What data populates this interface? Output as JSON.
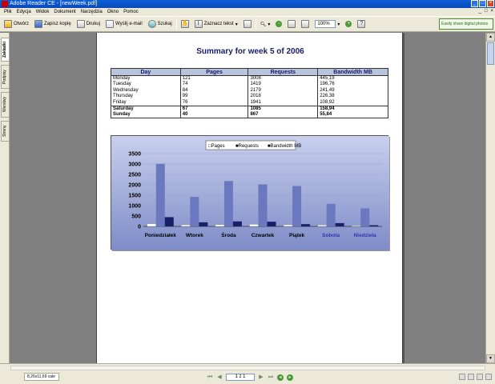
{
  "window": {
    "title": "Adobe Reader CE - [newWeek.pdf]",
    "controls": [
      "_",
      "□",
      "×"
    ]
  },
  "menu": {
    "items": [
      "Plik",
      "Edycja",
      "Widok",
      "Dokument",
      "Narzędzia",
      "Okno",
      "Pomoc"
    ],
    "doc_controls": [
      "_",
      "□",
      "×"
    ]
  },
  "toolbar": {
    "open_label": "Otwórz",
    "save_copy_label": "Zapisz kopię",
    "print_label": "Drukuj",
    "email_label": "Wyślij e-mail",
    "search_label": "Szukaj",
    "select_text_label": "Zaznacz tekst",
    "zoom_value": "100%",
    "sign_box": "Easily share digital photos"
  },
  "nav_tabs": [
    "Zakładki",
    "Podpisy",
    "Warstwy",
    "Strony"
  ],
  "document": {
    "title": "Summary for week 5 of 2006",
    "table": {
      "headers": [
        "Day",
        "Pages",
        "Requests",
        "Bandwidth MB"
      ],
      "rows": [
        [
          "Monday",
          "121",
          "3008",
          "445,19"
        ],
        [
          "Tuesday",
          "74",
          "1419",
          "196,76"
        ],
        [
          "Wednesday",
          "84",
          "2179",
          "241,49"
        ],
        [
          "Thursday",
          "99",
          "2018",
          "226,38"
        ],
        [
          "Friday",
          "76",
          "1941",
          "108,92"
        ],
        [
          "Saturday",
          "67",
          "1085",
          "158,94"
        ],
        [
          "Sunday",
          "40",
          "867",
          "55,84"
        ]
      ]
    }
  },
  "chart_data": {
    "type": "bar",
    "categories": [
      "Poniedziałek",
      "Wtorek",
      "Środa",
      "Czwartek",
      "Piątek",
      "Sobota",
      "Niedziela"
    ],
    "series": [
      {
        "name": "Pages",
        "values": [
          121,
          74,
          84,
          99,
          76,
          67,
          40
        ]
      },
      {
        "name": "Requests",
        "values": [
          3008,
          1419,
          2179,
          2018,
          1941,
          1085,
          867
        ]
      },
      {
        "name": "Bandwidth MB",
        "values": [
          445.19,
          196.76,
          241.49,
          226.38,
          108.92,
          158.94,
          55.84
        ]
      }
    ],
    "legend_labels": [
      "□Pages",
      "■Requests",
      "■Bandwidth MB"
    ],
    "y_ticks": [
      "0",
      "500",
      "1000",
      "1500",
      "2000",
      "2500",
      "3000",
      "3500"
    ],
    "ylim": [
      0,
      3500
    ],
    "grid": true,
    "legend_position": "top-center",
    "colors": {
      "pages": "#ffffff",
      "requests": "#6a78c0",
      "bandwidth": "#1a1f6a",
      "weekend_label": "#2a3aa8",
      "background_top": "#c8d0ec",
      "background_bottom": "#7e8cc8"
    }
  },
  "status": {
    "page_size": "8,26x11,69 cale",
    "page_counter": "1 z 1"
  }
}
